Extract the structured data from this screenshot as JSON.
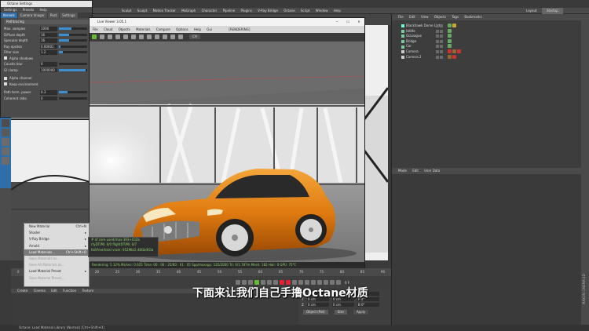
{
  "main_menu": [
    "File",
    "Edit",
    "View",
    "Objects",
    "Tags",
    "Bookmarks"
  ],
  "top_menu": [
    "Sculpt",
    "Sculpt",
    "Motion Tracker",
    "MoGraph",
    "Character",
    "Pipeline",
    "Plugins",
    "V-Ray Bridge",
    "Octane",
    "Script",
    "Window",
    "Help"
  ],
  "layout_label": "Layout",
  "layout_value": "Startup",
  "octane_settings": {
    "title": "Octane Settings",
    "menu": [
      "Settings",
      "Presets",
      "Help"
    ],
    "tabs": [
      "Kernels",
      "Camera Imager",
      "Post",
      "Settings"
    ],
    "section": "Pathtracing",
    "rows": [
      {
        "label": "Max. samples",
        "value": "1000",
        "fill": 0.45
      },
      {
        "label": "Diffuse depth",
        "value": "16",
        "fill": 0.35
      },
      {
        "label": "Specular depth",
        "value": "16",
        "fill": 0.35
      },
      {
        "label": "Ray epsilon",
        "value": "0.00001",
        "fill": 0.05
      },
      {
        "label": "Filter size",
        "value": "1.2",
        "fill": 0.15
      }
    ],
    "checks": [
      "Alpha shadows"
    ],
    "rows2": [
      {
        "label": "Caustic blur",
        "value": "0",
        "fill": 0.0
      },
      {
        "label": "GI clamp",
        "value": "1000000",
        "fill": 0.95
      }
    ],
    "checks2": [
      "Alpha channel",
      "Keep environment"
    ],
    "rows3": [
      {
        "label": "Path term. power",
        "value": "0.3",
        "fill": 0.3
      },
      {
        "label": "Coherent ratio",
        "value": "0",
        "fill": 0.0
      }
    ]
  },
  "live_viewer": {
    "title": "Live Viewer 3.05.1",
    "menu": [
      "File",
      "Cloud",
      "Objects",
      "Materials",
      "Compare",
      "Options",
      "Help",
      "Gui"
    ],
    "render_info": "[RENDERING]",
    "toolbar_select": "CH",
    "status_text": "Rendering: 5.12%   Ms/sec: 0.625   Time: 00 : 00 : 25/00 : 01 : 05   Spp/maxspp: 135/2000   Tri: 0/1.787m   Mesh: 182   Hair: 0   GPU: 75°C",
    "line_spacing": "Line Spacing: 70000 ms"
  },
  "objects": [
    {
      "name": "Blackhawk Dome Light",
      "color": "#6fd"
    },
    {
      "name": "Hdlife",
      "color": "#7c9"
    },
    {
      "name": "OcLeague",
      "color": "#7c9"
    },
    {
      "name": "Bridge",
      "color": "#7c9"
    },
    {
      "name": "Car",
      "color": "#7c9"
    },
    {
      "name": "Camera",
      "color": "#ccc"
    },
    {
      "name": "Camera.2",
      "color": "#ccc"
    }
  ],
  "attr_menu": [
    "Mode",
    "Edit",
    "User Data"
  ],
  "context_menu": [
    {
      "label": "New Material",
      "shortcut": "Ctrl+N",
      "state": "normal"
    },
    {
      "label": "Shader",
      "shortcut": "▸",
      "state": "normal"
    },
    {
      "label": "V-Ray Bridge",
      "shortcut": "▸",
      "state": "normal"
    },
    {
      "label": "Arnold",
      "shortcut": "▸",
      "state": "normal"
    },
    {
      "label": "Load Materials...",
      "shortcut": "Ctrl+Shift+O",
      "state": "highlight"
    },
    {
      "label": "Save Materials as...",
      "shortcut": "",
      "state": "disabled"
    },
    {
      "label": "Save All Materials as...",
      "shortcut": "",
      "state": "disabled"
    },
    {
      "label": "Load Material Preset",
      "shortcut": "▸",
      "state": "normal"
    },
    {
      "label": "Save Material Preset...",
      "shortcut": "",
      "state": "disabled"
    }
  ],
  "submenu": [
    "# of core used/max:393+432b",
    "rtyDT/Mi: 0/0   flightDT/Mi: 0/7",
    "fail/free/total vram: 952Mb/2.48Gb/6Gb"
  ],
  "ruler": [
    "0",
    "5",
    "10",
    "15",
    "20",
    "25",
    "30",
    "35",
    "40",
    "45",
    "50",
    "55",
    "60",
    "65",
    "70",
    "75",
    "80",
    "85",
    "90"
  ],
  "frame_display": "0 F",
  "material_menu": [
    "Create",
    "Cinema",
    "Edit",
    "Function",
    "Texture"
  ],
  "coords": {
    "rows": [
      {
        "axis": "X",
        "a": "0 cm",
        "b": "0 cm",
        "c": "H 0°"
      },
      {
        "axis": "Y",
        "a": "0 cm",
        "b": "0 cm",
        "c": "P 0°"
      },
      {
        "axis": "Z",
        "a": "0 cm",
        "b": "0 cm",
        "c": "B 0°"
      }
    ],
    "mode": "Object (Rel)",
    "size": "Size",
    "apply": "Apply"
  },
  "status_bar": "Octane:    Load Material Library (Normal) [Ctrl+Shift+O]",
  "subtitle": "下面来让我们自己手撸Octane材质",
  "render_side_label": "MAXON CINEMA 4D"
}
